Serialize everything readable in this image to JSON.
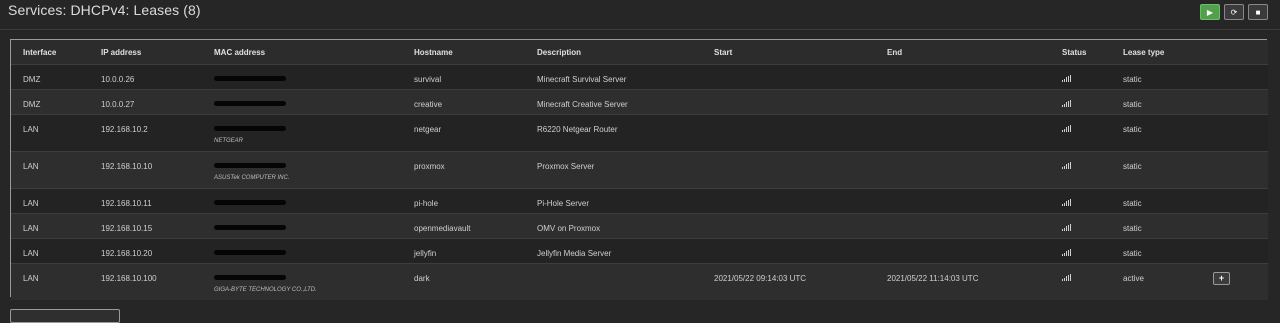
{
  "page": {
    "title": "Services: DHCPv4: Leases (8)"
  },
  "toolbar": {
    "start_icon": "play-icon",
    "restart_icon": "refresh-icon",
    "stop_icon": "stop-icon",
    "start_color": "#52a04d"
  },
  "table": {
    "columns": [
      "Interface",
      "IP address",
      "MAC address",
      "Hostname",
      "Description",
      "Start",
      "End",
      "Status",
      "Lease type"
    ],
    "rows": [
      {
        "interface": "DMZ",
        "ip": "10.0.0.26",
        "vendor": "",
        "hostname": "survival",
        "description": "Minecraft Survival Server",
        "start": "",
        "end": "",
        "status_icon": "signal-icon",
        "lease_type": "static"
      },
      {
        "interface": "DMZ",
        "ip": "10.0.0.27",
        "vendor": "",
        "hostname": "creative",
        "description": "Minecraft Creative Server",
        "start": "",
        "end": "",
        "status_icon": "signal-icon",
        "lease_type": "static"
      },
      {
        "interface": "LAN",
        "ip": "192.168.10.2",
        "vendor": "NETGEAR",
        "hostname": "netgear",
        "description": "R6220 Netgear Router",
        "start": "",
        "end": "",
        "status_icon": "signal-icon",
        "lease_type": "static"
      },
      {
        "interface": "LAN",
        "ip": "192.168.10.10",
        "vendor": "ASUSTek COMPUTER INC.",
        "hostname": "proxmox",
        "description": "Proxmox Server",
        "start": "",
        "end": "",
        "status_icon": "signal-icon",
        "lease_type": "static"
      },
      {
        "interface": "LAN",
        "ip": "192.168.10.11",
        "vendor": "",
        "hostname": "pi-hole",
        "description": "Pi-Hole Server",
        "start": "",
        "end": "",
        "status_icon": "signal-icon",
        "lease_type": "static"
      },
      {
        "interface": "LAN",
        "ip": "192.168.10.15",
        "vendor": "",
        "hostname": "openmediavault",
        "description": "OMV on Proxmox",
        "start": "",
        "end": "",
        "status_icon": "signal-icon",
        "lease_type": "static"
      },
      {
        "interface": "LAN",
        "ip": "192.168.10.20",
        "vendor": "",
        "hostname": "jellyfin",
        "description": "Jellyfin Media Server",
        "start": "",
        "end": "",
        "status_icon": "signal-icon",
        "lease_type": "static"
      },
      {
        "interface": "LAN",
        "ip": "192.168.10.100",
        "vendor": "GIGA-BYTE TECHNOLOGY CO.,LTD.",
        "hostname": "dark",
        "description": "",
        "start": "2021/05/22 09:14:03 UTC",
        "end": "2021/05/22 11:14:03 UTC",
        "status_icon": "signal-icon",
        "lease_type": "active",
        "action_label": "+"
      }
    ]
  }
}
